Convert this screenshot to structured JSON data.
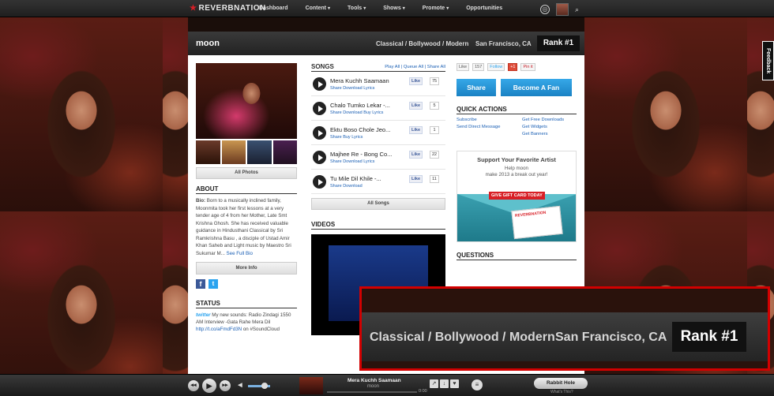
{
  "nav": {
    "logo": "REVERBNATION",
    "items": [
      {
        "label": "Dashboard",
        "caret": ""
      },
      {
        "label": "Content",
        "caret": "▾"
      },
      {
        "label": "Tools",
        "caret": "▾"
      },
      {
        "label": "Shows",
        "caret": "▾"
      },
      {
        "label": "Promote",
        "caret": "▾"
      },
      {
        "label": "Opportunities",
        "caret": ""
      }
    ],
    "icons": [
      "globe-icon",
      "avatar",
      "search-icon"
    ]
  },
  "header": {
    "artist": "moon",
    "genre": "Classical / Bollywood / Modern",
    "city": "San Francisco, CA",
    "rank": "Rank #1"
  },
  "left": {
    "all_photos": "All Photos",
    "about_title": "ABOUT",
    "bio_label": "Bio:",
    "bio_text": "Born to a musically inclined family, Moonmita took her first lessons at a very tender age of 4 from her Mother, Late Smt Krishna Ghosh. She has received valuable guidance in Hindusthani Classical by Sri Ramkrishna Basu , a disciple of Ustad Amir Khan Saheb and Light music by Maestro Sri Sukumar M...",
    "see_full_bio": "See Full Bio",
    "more_info": "More Info",
    "status_title": "STATUS",
    "status_brand": "twitter",
    "status_text": "My new sounds: Radio Zindagi 1550 AM Interview -Gata Rahe Mera Dil",
    "status_link": "http://t.co/aFmdFd3N",
    "status_suffix": "on #SoundCloud"
  },
  "songs": {
    "title": "SONGS",
    "links": "Play All | Queue All | Share All",
    "list": [
      {
        "title": "Mera Kuchh Saamaan",
        "links": "Share  Download  Lyrics",
        "likes": "75"
      },
      {
        "title": "Chalo Tumko Lekar -...",
        "links": "Share  Download  Buy  Lyrics",
        "likes": "5"
      },
      {
        "title": "Ektu Boso Chole Jeo...",
        "links": "Share  Buy  Lyrics",
        "likes": "1"
      },
      {
        "title": "Majhee Re - Bong Co...",
        "links": "Share  Download  Lyrics",
        "likes": "22"
      },
      {
        "title": "Tu Mile Dil Khile -...",
        "links": "Share  Download",
        "likes": "11"
      }
    ],
    "like_label": "Like",
    "all_songs": "All Songs",
    "videos_title": "VIDEOS"
  },
  "right": {
    "fb_like": "Like",
    "fb_count": "157",
    "follow": "Follow",
    "gplus": "+1",
    "pinit": "Pin it",
    "share": "Share",
    "become_fan": "Become A Fan",
    "qa_title": "QUICK ACTIONS",
    "qa_links": [
      "Subscribe",
      "Get Free Downloads",
      "Send Direct Message",
      "Get Widgets",
      "",
      "Get Banners"
    ],
    "gift_title": "Support Your Favorite Artist",
    "gift_line1": "Help moon",
    "gift_line2": "make 2013 a break out year!",
    "gift_button": "GIVE GIFT CARD TODAY",
    "gift_card": "REVERBNATION",
    "questions_title": "QUESTIONS"
  },
  "callout": {
    "genre": "Classical / Bollywood / Modern",
    "city": "San Francisco, CA",
    "rank": "Rank #1"
  },
  "feedback": "Feedback",
  "player": {
    "title": "Mera Kuchh Saamaan",
    "artist": "moon",
    "time": "0:00",
    "rabbit_hole": "Rabbit Hole",
    "whats_this": "What's This?"
  }
}
